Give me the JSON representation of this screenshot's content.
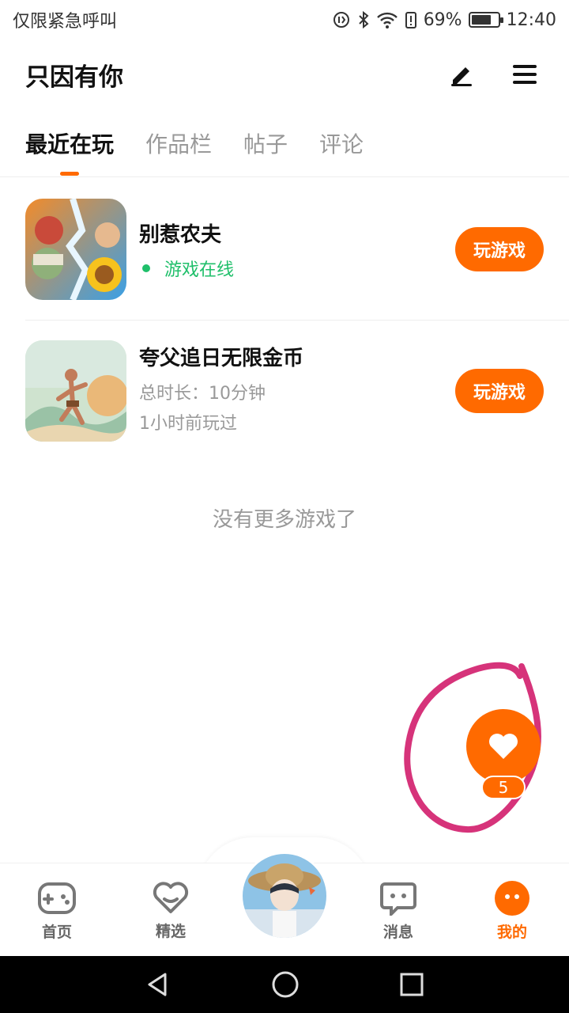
{
  "status_bar": {
    "carrier": "仅限紧急呼叫",
    "battery": "69%",
    "time": "12:40"
  },
  "header": {
    "title": "只因有你",
    "edit_icon": "pen-icon",
    "menu_icon": "hamburger-icon"
  },
  "tabs": [
    {
      "label": "最近在玩",
      "active": true
    },
    {
      "label": "作品栏",
      "active": false
    },
    {
      "label": "帖子",
      "active": false
    },
    {
      "label": "评论",
      "active": false
    }
  ],
  "games": [
    {
      "name": "别惹农夫",
      "status": "游戏在线",
      "button": "玩游戏"
    },
    {
      "name": "夸父追日无限金币",
      "duration": "总时长：10分钟",
      "last_played": "1小时前玩过",
      "button": "玩游戏"
    }
  ],
  "no_more": "没有更多游戏了",
  "like": {
    "count": "5",
    "icon": "heart-icon"
  },
  "bottom_nav": [
    {
      "label": "首页",
      "icon": "gamepad-icon"
    },
    {
      "label": "精选",
      "icon": "heart-outline-icon"
    },
    {
      "label": "",
      "icon": "avatar"
    },
    {
      "label": "消息",
      "icon": "chat-icon"
    },
    {
      "label": "我的",
      "icon": "more-dots-icon",
      "active": true
    }
  ],
  "colors": {
    "accent": "#ff6a00",
    "online": "#1fbf6a",
    "annotation": "#d6337a"
  }
}
